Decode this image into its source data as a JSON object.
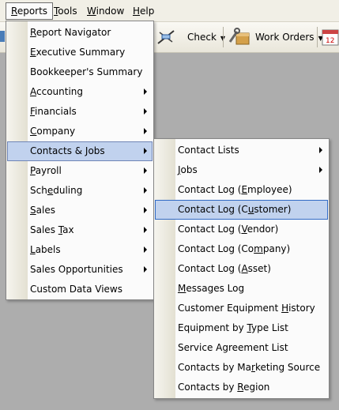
{
  "menubar": {
    "items": [
      {
        "label": "Reports",
        "mnemonic": "R"
      },
      {
        "label": "Tools",
        "mnemonic": "T"
      },
      {
        "label": "Window",
        "mnemonic": "W"
      },
      {
        "label": "Help",
        "mnemonic": "H"
      }
    ]
  },
  "toolbar": {
    "check_label": "Check",
    "work_orders_label": "Work Orders",
    "calendar_day": "12"
  },
  "reports_menu": {
    "items": [
      {
        "label": "Report Navigator",
        "mnemonic_index": 0,
        "has_submenu": false
      },
      {
        "label": "Executive Summary",
        "mnemonic_index": 0,
        "has_submenu": false
      },
      {
        "label": "Bookkeeper's Summary",
        "mnemonic_index": -1,
        "has_submenu": false
      },
      {
        "label": "Accounting",
        "mnemonic_index": 0,
        "has_submenu": true
      },
      {
        "label": "Financials",
        "mnemonic_index": 0,
        "has_submenu": true
      },
      {
        "label": "Company",
        "mnemonic_index": 0,
        "has_submenu": true
      },
      {
        "label": "Contacts & Jobs",
        "mnemonic_index": -1,
        "has_submenu": true
      },
      {
        "label": "Payroll",
        "mnemonic_index": 0,
        "has_submenu": true
      },
      {
        "label": "Scheduling",
        "mnemonic_index": 3,
        "has_submenu": true
      },
      {
        "label": "Sales",
        "mnemonic_index": 0,
        "has_submenu": true
      },
      {
        "label": "Sales Tax",
        "mnemonic_index": 6,
        "has_submenu": true
      },
      {
        "label": "Labels",
        "mnemonic_index": 0,
        "has_submenu": true
      },
      {
        "label": "Sales Opportunities",
        "mnemonic_index": -1,
        "has_submenu": true
      },
      {
        "label": "Custom Data Views",
        "mnemonic_index": -1,
        "has_submenu": false
      }
    ]
  },
  "contacts_jobs_menu": {
    "items": [
      {
        "label": "Contact Lists",
        "mnemonic_index": -1,
        "has_submenu": true
      },
      {
        "label": "Jobs",
        "mnemonic_index": 0,
        "has_submenu": true
      },
      {
        "label": "Contact Log (Employee)",
        "mnemonic_index": 13,
        "has_submenu": false
      },
      {
        "label": "Contact Log (Customer)",
        "mnemonic_index": 14,
        "has_submenu": false
      },
      {
        "label": "Contact Log (Vendor)",
        "mnemonic_index": 13,
        "has_submenu": false
      },
      {
        "label": "Contact Log (Company)",
        "mnemonic_index": 15,
        "has_submenu": false
      },
      {
        "label": "Contact Log (Asset)",
        "mnemonic_index": 13,
        "has_submenu": false
      },
      {
        "label": "Messages Log",
        "mnemonic_index": 0,
        "has_submenu": false
      },
      {
        "label": "Customer Equipment History",
        "mnemonic_index": 19,
        "has_submenu": false
      },
      {
        "label": "Equipment by Type List",
        "mnemonic_index": 13,
        "has_submenu": false
      },
      {
        "label": "Service Agreement List",
        "mnemonic_index": -1,
        "has_submenu": false
      },
      {
        "label": "Contacts by Marketing Source",
        "mnemonic_index": 14,
        "has_submenu": false
      },
      {
        "label": "Contacts by Region",
        "mnemonic_index": 12,
        "has_submenu": false
      }
    ]
  },
  "colors": {
    "highlight_fill": "#c1d2ee",
    "highlight_border": "#316ac5",
    "desktop": "#adadad"
  }
}
